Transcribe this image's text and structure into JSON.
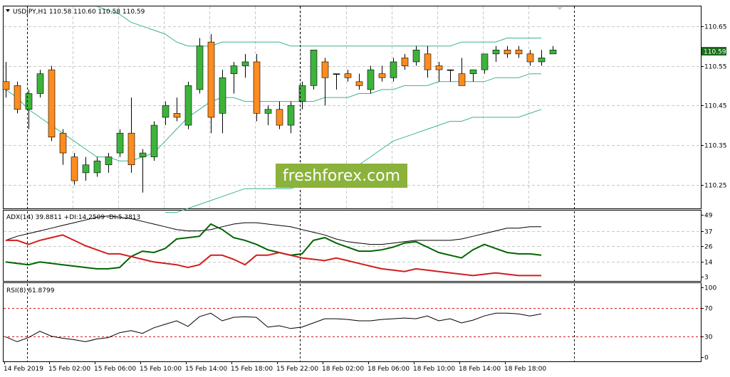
{
  "price_pane": {
    "header": "USDJPY,H1  110.58 110.60 110.58 110.59",
    "price_badge": "110.59",
    "axis_ticks": [
      "110.65",
      "110.55",
      "110.45",
      "110.35",
      "110.25"
    ],
    "watermark": "freshforex.com",
    "colors": {
      "bull": "#3cb43c",
      "bear": "#ff8c1e",
      "bands": "#3cb48c",
      "badge_bg": "#1a6b1a"
    }
  },
  "adx_pane": {
    "header": "ADX(14) 39.8811 +DI:14.2509 -DI:5.3813",
    "axis_ticks": [
      "49",
      "37",
      "26",
      "14",
      "3"
    ],
    "colors": {
      "adx": "#000000",
      "plus_di": "#006400",
      "minus_di": "#d21e1e"
    }
  },
  "rsi_pane": {
    "header": "RSI(8) 61.8799",
    "axis_ticks": [
      "100",
      "70",
      "30",
      "0"
    ],
    "levels": [
      70,
      30
    ],
    "colors": {
      "rsi": "#000000",
      "levels": "#d21e1e"
    }
  },
  "time_axis": [
    "14 Feb 2019",
    "15 Feb 02:00",
    "15 Feb 06:00",
    "15 Feb 10:00",
    "15 Feb 14:00",
    "15 Feb 18:00",
    "15 Feb 22:00",
    "18 Feb 02:00",
    "18 Feb 06:00",
    "18 Feb 10:00",
    "18 Feb 14:00",
    "18 Feb 18:00"
  ],
  "chart_data": [
    {
      "type": "candlestick",
      "title": "USDJPY,H1",
      "ylim": [
        110.19,
        110.7
      ],
      "yticks": [
        110.25,
        110.35,
        110.45,
        110.55,
        110.65
      ],
      "candles": [
        {
          "o": 110.51,
          "h": 110.56,
          "l": 110.47,
          "c": 110.49
        },
        {
          "o": 110.5,
          "h": 110.51,
          "l": 110.43,
          "c": 110.44
        },
        {
          "o": 110.44,
          "h": 110.49,
          "l": 110.39,
          "c": 110.48
        },
        {
          "o": 110.48,
          "h": 110.54,
          "l": 110.47,
          "c": 110.53
        },
        {
          "o": 110.54,
          "h": 110.55,
          "l": 110.36,
          "c": 110.37
        },
        {
          "o": 110.38,
          "h": 110.39,
          "l": 110.3,
          "c": 110.33
        },
        {
          "o": 110.32,
          "h": 110.33,
          "l": 110.25,
          "c": 110.26
        },
        {
          "o": 110.28,
          "h": 110.32,
          "l": 110.26,
          "c": 110.3
        },
        {
          "o": 110.28,
          "h": 110.32,
          "l": 110.27,
          "c": 110.31
        },
        {
          "o": 110.3,
          "h": 110.33,
          "l": 110.28,
          "c": 110.32
        },
        {
          "o": 110.33,
          "h": 110.39,
          "l": 110.32,
          "c": 110.38
        },
        {
          "o": 110.38,
          "h": 110.47,
          "l": 110.28,
          "c": 110.3
        },
        {
          "o": 110.32,
          "h": 110.34,
          "l": 110.23,
          "c": 110.33
        },
        {
          "o": 110.32,
          "h": 110.41,
          "l": 110.31,
          "c": 110.4
        },
        {
          "o": 110.42,
          "h": 110.46,
          "l": 110.4,
          "c": 110.45
        },
        {
          "o": 110.43,
          "h": 110.47,
          "l": 110.41,
          "c": 110.42
        },
        {
          "o": 110.4,
          "h": 110.51,
          "l": 110.39,
          "c": 110.5
        },
        {
          "o": 110.49,
          "h": 110.62,
          "l": 110.48,
          "c": 110.6
        },
        {
          "o": 110.61,
          "h": 110.63,
          "l": 110.38,
          "c": 110.42
        },
        {
          "o": 110.43,
          "h": 110.54,
          "l": 110.38,
          "c": 110.52
        },
        {
          "o": 110.53,
          "h": 110.56,
          "l": 110.48,
          "c": 110.55
        },
        {
          "o": 110.55,
          "h": 110.58,
          "l": 110.52,
          "c": 110.56
        },
        {
          "o": 110.56,
          "h": 110.58,
          "l": 110.41,
          "c": 110.43
        },
        {
          "o": 110.43,
          "h": 110.45,
          "l": 110.4,
          "c": 110.44
        },
        {
          "o": 110.44,
          "h": 110.46,
          "l": 110.39,
          "c": 110.4
        },
        {
          "o": 110.4,
          "h": 110.46,
          "l": 110.38,
          "c": 110.45
        },
        {
          "o": 110.46,
          "h": 110.51,
          "l": 110.44,
          "c": 110.5
        },
        {
          "o": 110.5,
          "h": 110.59,
          "l": 110.49,
          "c": 110.59
        },
        {
          "o": 110.56,
          "h": 110.57,
          "l": 110.45,
          "c": 110.52
        },
        {
          "o": 110.53,
          "h": 110.53,
          "l": 110.49,
          "c": 110.53
        },
        {
          "o": 110.53,
          "h": 110.54,
          "l": 110.51,
          "c": 110.52
        },
        {
          "o": 110.51,
          "h": 110.53,
          "l": 110.49,
          "c": 110.5
        },
        {
          "o": 110.49,
          "h": 110.55,
          "l": 110.48,
          "c": 110.54
        },
        {
          "o": 110.53,
          "h": 110.55,
          "l": 110.51,
          "c": 110.52
        },
        {
          "o": 110.52,
          "h": 110.57,
          "l": 110.51,
          "c": 110.56
        },
        {
          "o": 110.57,
          "h": 110.58,
          "l": 110.54,
          "c": 110.55
        },
        {
          "o": 110.56,
          "h": 110.6,
          "l": 110.55,
          "c": 110.59
        },
        {
          "o": 110.58,
          "h": 110.6,
          "l": 110.52,
          "c": 110.54
        },
        {
          "o": 110.55,
          "h": 110.56,
          "l": 110.51,
          "c": 110.54
        },
        {
          "o": 110.54,
          "h": 110.54,
          "l": 110.51,
          "c": 110.54
        },
        {
          "o": 110.53,
          "h": 110.57,
          "l": 110.51,
          "c": 110.5
        },
        {
          "o": 110.53,
          "h": 110.54,
          "l": 110.51,
          "c": 110.54
        },
        {
          "o": 110.54,
          "h": 110.58,
          "l": 110.53,
          "c": 110.58
        },
        {
          "o": 110.58,
          "h": 110.6,
          "l": 110.56,
          "c": 110.59
        },
        {
          "o": 110.59,
          "h": 110.6,
          "l": 110.57,
          "c": 110.58
        },
        {
          "o": 110.59,
          "h": 110.6,
          "l": 110.57,
          "c": 110.58
        },
        {
          "o": 110.58,
          "h": 110.59,
          "l": 110.55,
          "c": 110.56
        },
        {
          "o": 110.56,
          "h": 110.59,
          "l": 110.55,
          "c": 110.57
        },
        {
          "o": 110.58,
          "h": 110.6,
          "l": 110.58,
          "c": 110.59
        }
      ],
      "bands_upper": [
        null,
        null,
        null,
        null,
        null,
        null,
        null,
        null,
        110.7,
        110.69,
        110.68,
        110.66,
        110.65,
        110.64,
        110.63,
        110.61,
        110.6,
        110.6,
        110.6,
        110.61,
        110.61,
        110.61,
        110.61,
        110.61,
        110.61,
        110.6,
        110.6,
        110.6,
        110.6,
        110.6,
        110.6,
        110.6,
        110.6,
        110.6,
        110.6,
        110.6,
        110.6,
        110.6,
        110.6,
        110.6,
        110.61,
        110.61,
        110.61,
        110.61,
        110.62,
        110.62,
        110.62,
        110.62,
        null
      ],
      "bands_middle": [
        110.49,
        110.47,
        110.44,
        110.42,
        110.4,
        110.38,
        110.36,
        110.34,
        110.32,
        110.32,
        110.31,
        110.31,
        110.32,
        110.33,
        110.36,
        110.39,
        110.42,
        110.44,
        110.46,
        110.47,
        110.47,
        110.46,
        110.46,
        110.46,
        110.46,
        110.46,
        110.46,
        110.46,
        110.47,
        110.47,
        110.47,
        110.48,
        110.48,
        110.49,
        110.49,
        110.5,
        110.5,
        110.5,
        110.51,
        110.51,
        110.51,
        110.51,
        110.51,
        110.52,
        110.52,
        110.52,
        110.53,
        110.53,
        null
      ],
      "bands_lower": [
        null,
        null,
        null,
        null,
        null,
        null,
        null,
        null,
        null,
        null,
        null,
        null,
        null,
        null,
        110.18,
        110.18,
        110.19,
        110.2,
        110.21,
        110.22,
        110.23,
        110.24,
        110.24,
        110.24,
        110.24,
        110.24,
        110.25,
        110.26,
        110.26,
        110.27,
        110.28,
        110.3,
        110.32,
        110.34,
        110.36,
        110.37,
        110.38,
        110.39,
        110.4,
        110.41,
        110.41,
        110.42,
        110.42,
        110.42,
        110.42,
        110.42,
        110.43,
        110.44,
        null
      ]
    },
    {
      "type": "line",
      "title": "ADX(14) 39.8811 +DI:14.2509 -DI:5.3813",
      "ylim": [
        0,
        52
      ],
      "yticks": [
        3,
        14,
        26,
        37,
        49
      ],
      "series": [
        {
          "name": "ADX",
          "values": [
            30,
            33,
            35,
            37,
            39,
            41,
            43,
            45,
            47,
            48,
            47,
            46,
            44,
            42,
            40,
            38,
            37,
            37,
            38,
            40,
            42,
            43,
            43,
            42,
            41,
            40,
            38,
            36,
            34,
            31,
            29,
            28,
            27,
            27,
            28,
            29,
            30,
            30,
            30,
            30,
            31,
            33,
            35,
            37,
            39,
            39,
            40,
            40
          ]
        },
        {
          "name": "+DI",
          "values": [
            14,
            13,
            12,
            14,
            13,
            12,
            11,
            10,
            9,
            9,
            10,
            18,
            22,
            21,
            24,
            31,
            32,
            33,
            42,
            38,
            32,
            30,
            27,
            23,
            21,
            19,
            20,
            30,
            32,
            28,
            25,
            22,
            22,
            23,
            25,
            28,
            29,
            25,
            21,
            19,
            17,
            23,
            27,
            24,
            21,
            20,
            20,
            19
          ]
        },
        {
          "name": "-DI",
          "values": [
            30,
            30,
            27,
            30,
            32,
            34,
            30,
            26,
            23,
            20,
            20,
            18,
            16,
            14,
            13,
            12,
            10,
            12,
            19,
            19,
            16,
            12,
            19,
            19,
            21,
            19,
            17,
            16,
            15,
            17,
            15,
            13,
            11,
            9,
            8,
            7,
            9,
            8,
            7,
            6,
            5,
            4,
            5,
            6,
            5,
            4,
            4,
            4
          ]
        }
      ]
    },
    {
      "type": "line",
      "title": "RSI(8) 61.8799",
      "ylim": [
        0,
        100
      ],
      "yticks": [
        0,
        30,
        70,
        100
      ],
      "series": [
        {
          "name": "RSI(8)",
          "values": [
            29,
            22,
            28,
            37,
            30,
            27,
            25,
            22,
            26,
            28,
            35,
            38,
            34,
            42,
            47,
            52,
            44,
            58,
            63,
            52,
            57,
            58,
            57,
            43,
            45,
            41,
            43,
            49,
            55,
            55,
            54,
            52,
            52,
            54,
            55,
            56,
            55,
            59,
            52,
            55,
            49,
            53,
            59,
            63,
            63,
            62,
            59,
            62
          ]
        }
      ]
    }
  ]
}
